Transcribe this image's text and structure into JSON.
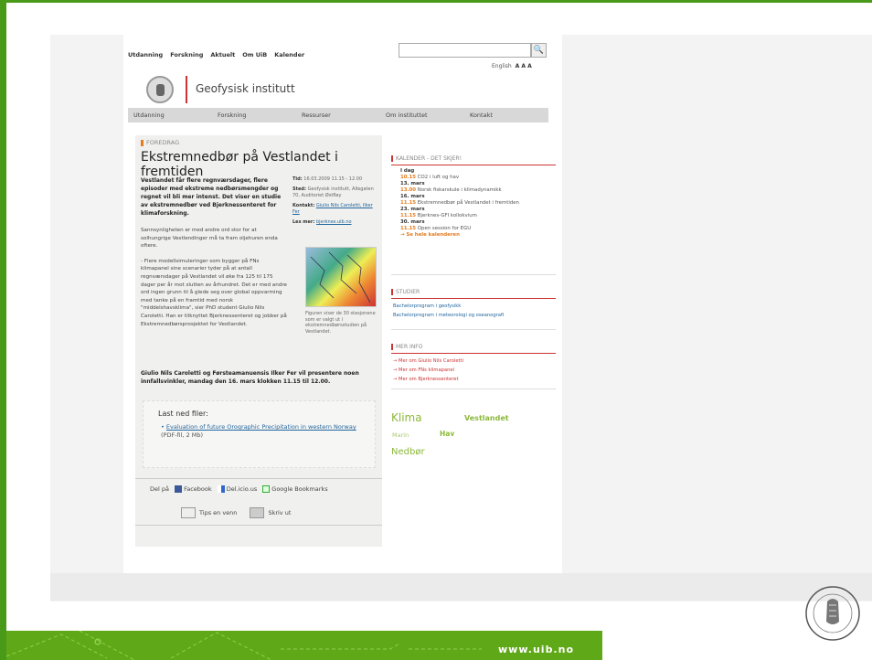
{
  "topnav": [
    "Utdanning",
    "Forskning",
    "Aktuelt",
    "Om UiB",
    "Kalender"
  ],
  "search": {
    "placeholder": ""
  },
  "lang": {
    "english": "English",
    "sizes": "A A A"
  },
  "institute": "Geofysisk institutt",
  "mainnav": [
    "Utdanning",
    "Forskning",
    "Ressurser",
    "Om instituttet",
    "Kontakt"
  ],
  "article": {
    "tag": "FOREDRAG",
    "headline": "Ekstremnedbør på Vestlandet i fremtiden",
    "lead": "Vestlandet får flere regnværsdager, flere episoder med ekstreme nedbørsmengder og regnet vil bli mer intenst. Det viser en studie av ekstremnedbør ved Bjerknessenteret for klimaforskning.",
    "body1": "Sannsynligheten er med andre ord stor for at solhungrige Vestlendinger må ta fram oljehuren enda oftere.",
    "body2": "- Flere modellsimuleringer som bygger på FNs klimapanel sine scenarier tyder på at antall regnværsdager på Vestlandet vil øke fra 125 til 175 dager per år mot slutten av århundret. Det er med andre ord ingen grunn til å glede seg over global oppvarming med tanke på en framtid med norsk \"middelshavsklima\", sier PhD student Giulio Nils Caroletti. Han er tilknyttet Bjerknessenteret og jobber på Ekstremnedbørsprosjektet for Vestlandet.",
    "footline": "Giulio Nils Caroletti og Førsteamanuensis Ilker Fer vil presentere noen innfallsvinkler, mandag den 16. mars klokken 11.15 til 12.00.",
    "info": {
      "tid_label": "Tid:",
      "tid": "16.03.2009 11.15 - 12.00",
      "sted_label": "Sted:",
      "sted": "Geofysisk institutt, Allegaten 70, Auditoriet Østfløy",
      "kontakt_label": "Kontakt:",
      "kontakt": "Giulio Nils Caroletti, Ilker Fer",
      "les_label": "Les mer:",
      "les": "bjerknes.uib.no"
    },
    "caption": "Figuren viser de 30 stasjonene som er valgt ut i ekstremnedbørsstudien på Vestlandet.",
    "files_title": "Last ned filer:",
    "file_link": "Evaluation of future Orographic Precipitation in western Norway",
    "file_meta": "(PDF-fil, 2 Mb)",
    "share_label": "Del på",
    "share": [
      "Facebook",
      "Del.icio.us",
      "Google Bookmarks"
    ],
    "tips": "Tips en venn",
    "print": "Skriv ut"
  },
  "calendar": {
    "title": "KALENDER - DET SKJER!",
    "entries": [
      {
        "day": "I dag",
        "time": "10.15",
        "text": "CO2 i luft og hav"
      },
      {
        "day": "13. mars",
        "time": "13.00",
        "text": "Norsk fiskarskule i klimadynamikk"
      },
      {
        "day": "16. mars",
        "time": "11.15",
        "text": "Ekstremnedbør på Vestlandet i fremtiden"
      },
      {
        "day": "23. mars",
        "time": "11.15",
        "text": "Bjerknes-GFI kollokvium"
      },
      {
        "day": "30. mars",
        "time": "11.15",
        "text": "Open session for EGU"
      }
    ],
    "more": "→ Se hele kalenderen"
  },
  "studier": {
    "title": "STUDIER",
    "links": [
      "Bachelorprogram i geofysikk",
      "Bachelorprogram i meteorologi og oseanografi"
    ]
  },
  "merinfo": {
    "title": "MER INFO",
    "links": [
      "→ Mer om Giulio Nils Caroletti",
      "→ Mer om FNs klimapanel",
      "→ Mer om Bjerknessenteret"
    ]
  },
  "tagcloud": [
    "Klima",
    "Vestlandet",
    "Marin",
    "Hav",
    "Nedbør"
  ],
  "footer_url": "www.uib.no",
  "colors": {
    "green": "#5fa817",
    "orange": "#e57b1e",
    "red": "#cc3333",
    "link": "#23669e"
  }
}
